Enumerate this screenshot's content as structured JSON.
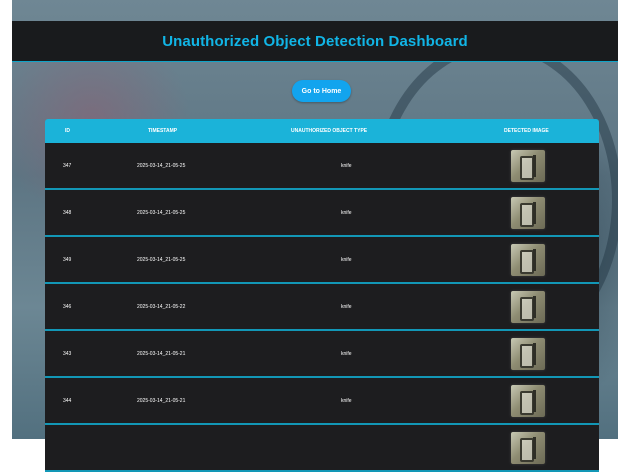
{
  "header": {
    "title": "Unauthorized Object Detection Dashboard"
  },
  "nav": {
    "home_label": "Go to Home"
  },
  "table": {
    "columns": [
      "ID",
      "TIMESTAMP",
      "UNAUTHORIZED OBJECT TYPE",
      "DETECTED IMAGE"
    ],
    "rows": [
      {
        "id": "347",
        "timestamp": "2025-03-14_21-05-25",
        "type": "knife"
      },
      {
        "id": "348",
        "timestamp": "2025-03-14_21-05-25",
        "type": "knife"
      },
      {
        "id": "349",
        "timestamp": "2025-03-14_21-05-25",
        "type": "knife"
      },
      {
        "id": "346",
        "timestamp": "2025-03-14_21-05-22",
        "type": "knife"
      },
      {
        "id": "343",
        "timestamp": "2025-03-14_21-05-21",
        "type": "knife"
      },
      {
        "id": "344",
        "timestamp": "2025-03-14_21-05-21",
        "type": "knife"
      }
    ]
  },
  "colors": {
    "accent": "#11b5e6",
    "header_bg": "#191b1d",
    "row_bg": "#1d1d1f",
    "button": "#12a4ee"
  }
}
